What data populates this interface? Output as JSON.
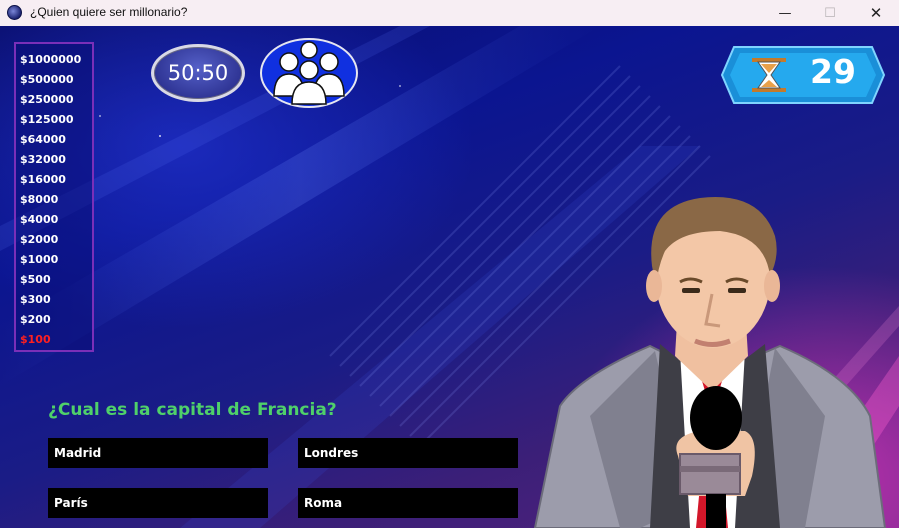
{
  "window": {
    "title": "¿Quien quiere ser millonario?",
    "minimize_glyph": "—",
    "maximize_glyph": "☐",
    "close_glyph": "✕"
  },
  "ladder": {
    "prizes": [
      "$1000000",
      "$500000",
      "$250000",
      "$125000",
      "$64000",
      "$32000",
      "$16000",
      "$8000",
      "$4000",
      "$2000",
      "$1000",
      "$500",
      "$300",
      "$200",
      "$100"
    ],
    "current_index": 14,
    "current_color": "#ff2020"
  },
  "lifelines": {
    "fifty_fifty_label": "50:50",
    "audience_icon": "audience-icon"
  },
  "timer": {
    "seconds": "29",
    "icon": "hourglass-icon"
  },
  "question": {
    "text": "¿Cual es la capital de Francia?",
    "answers": [
      "Madrid",
      "Londres",
      "París",
      "Roma"
    ]
  },
  "colors": {
    "question_text": "#4fd06a",
    "answer_bg": "#000000",
    "ladder_border": "#7a2fb8"
  }
}
